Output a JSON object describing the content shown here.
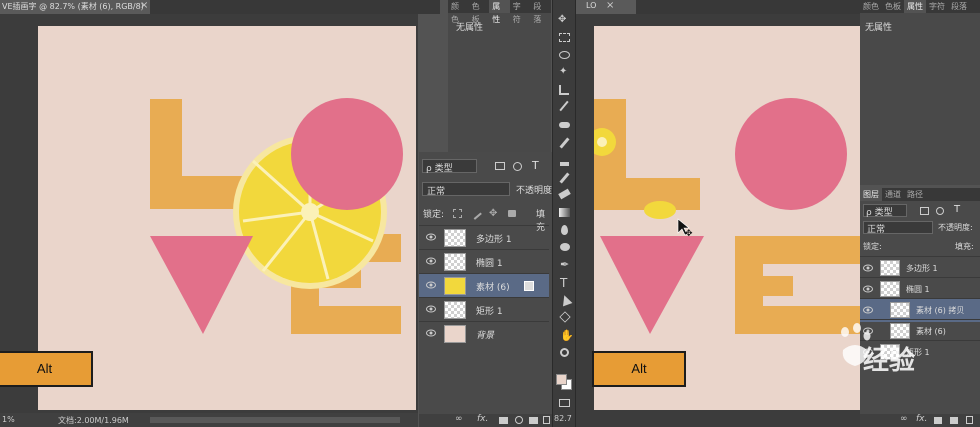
{
  "left_doc": {
    "tab_title": "VE插画字 @ 82.7% (素材 (6), RGB/8)",
    "close_glyph": "×",
    "status_zoom": "1%",
    "status_doc": "文档:2.00M/1.96M"
  },
  "mid_panel": {
    "tabs": [
      "颜色",
      "色板",
      "属性",
      "字符",
      "段落"
    ],
    "active_tab": "属性",
    "props_text": "无属性"
  },
  "layers_panel_mid": {
    "filter_label": "ρ 类型",
    "blend_mode": "正常",
    "opacity_label": "不透明度",
    "lock_label": "锁定:",
    "fill_label": "填充",
    "layers": [
      {
        "name": "多边形 1",
        "selected": false
      },
      {
        "name": "椭圆 1",
        "selected": false
      },
      {
        "name": "素材 (6)",
        "selected": true
      },
      {
        "name": "矩形 1",
        "selected": false
      },
      {
        "name": "背景",
        "selected": false
      }
    ],
    "footer_icons": [
      "link-icon",
      "fx-icon",
      "mask-icon",
      "adjustment-icon",
      "folder-icon",
      "new-layer-icon",
      "trash-icon"
    ],
    "fx_label": "fx."
  },
  "toolbar": {
    "tools": [
      "move-tool-icon",
      "marquee-tool-icon",
      "lasso-tool-icon",
      "magic-wand-icon",
      "crop-tool-icon",
      "eyedropper-icon",
      "healing-brush-icon",
      "brush-tool-icon",
      "clone-stamp-icon",
      "history-brush-icon",
      "eraser-icon",
      "gradient-tool-icon",
      "blur-tool-icon",
      "dodge-tool-icon",
      "pen-tool-icon",
      "type-tool-icon",
      "path-select-icon",
      "shape-tool-icon",
      "hand-tool-icon",
      "zoom-tool-icon"
    ],
    "type_glyph": "T",
    "zoom_status": "82.7"
  },
  "right_doc": {
    "tab_title": "LO",
    "close_glyph": "×"
  },
  "right_panel": {
    "tabs": [
      "颜色",
      "色板",
      "属性",
      "字符",
      "段落"
    ],
    "active_tab": "属性",
    "props_text": "无属性",
    "layer_tabs": [
      "图层",
      "通道",
      "路径"
    ],
    "filter_label": "ρ 类型",
    "blend_mode": "正常",
    "opacity_label": "不透明度:",
    "lock_label": "锁定:",
    "fill_label": "填充:",
    "layers": [
      {
        "name": "多边形 1",
        "selected": false
      },
      {
        "name": "椭圆 1",
        "selected": false
      },
      {
        "name": "素材 (6) 拷贝",
        "selected": true
      },
      {
        "name": "素材 (6)",
        "selected": false
      },
      {
        "name": "矩形 1",
        "selected": false
      }
    ],
    "fx_label": "fx."
  },
  "alt_key": {
    "label": "Alt"
  },
  "watermark": {
    "text": "经验"
  },
  "colors": {
    "orange": "#e8ac53",
    "pink": "#e2708a",
    "canvas": "#ead5cb",
    "lemon": "#f2d83c",
    "selected_layer": "#5a6a86"
  }
}
